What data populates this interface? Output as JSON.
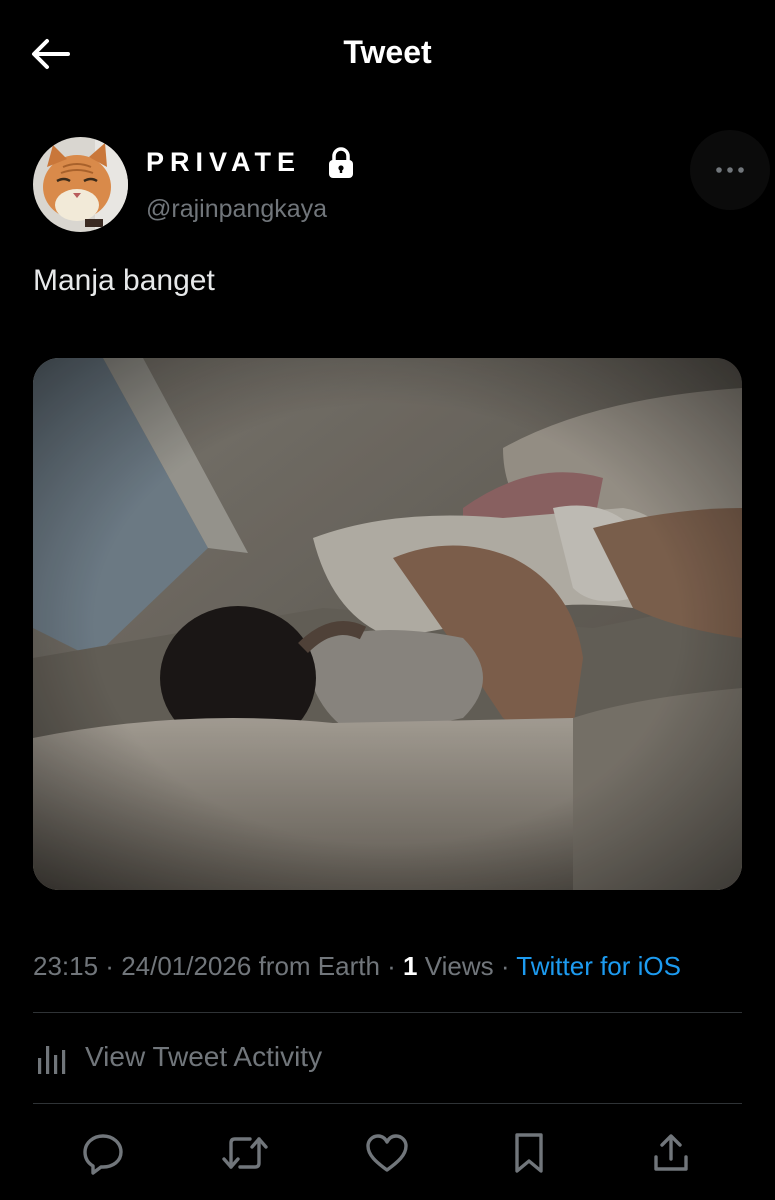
{
  "header": {
    "title": "Tweet",
    "back_icon": "arrow-left-icon"
  },
  "author": {
    "display_name": "PRIVATE",
    "handle": "@rajinpangkaya",
    "protected_icon": "lock-icon",
    "avatar_desc_icon": "cat-avatar"
  },
  "tweet": {
    "text": "Manja banget",
    "time": "23:15",
    "date": "24/01/2026",
    "location": "from Earth",
    "views_count": "1",
    "views_label": "Views",
    "source": "Twitter for iOS",
    "sep": " · "
  },
  "activity": {
    "label": "View Tweet Activity",
    "icon": "bar-chart-icon"
  },
  "actions": [
    "reply-icon",
    "retweet-icon",
    "like-icon",
    "bookmark-icon",
    "share-icon"
  ],
  "colors": {
    "background": "#000000",
    "link": "#1d9bf0",
    "muted": "#71767b",
    "divider": "#2f3336"
  }
}
